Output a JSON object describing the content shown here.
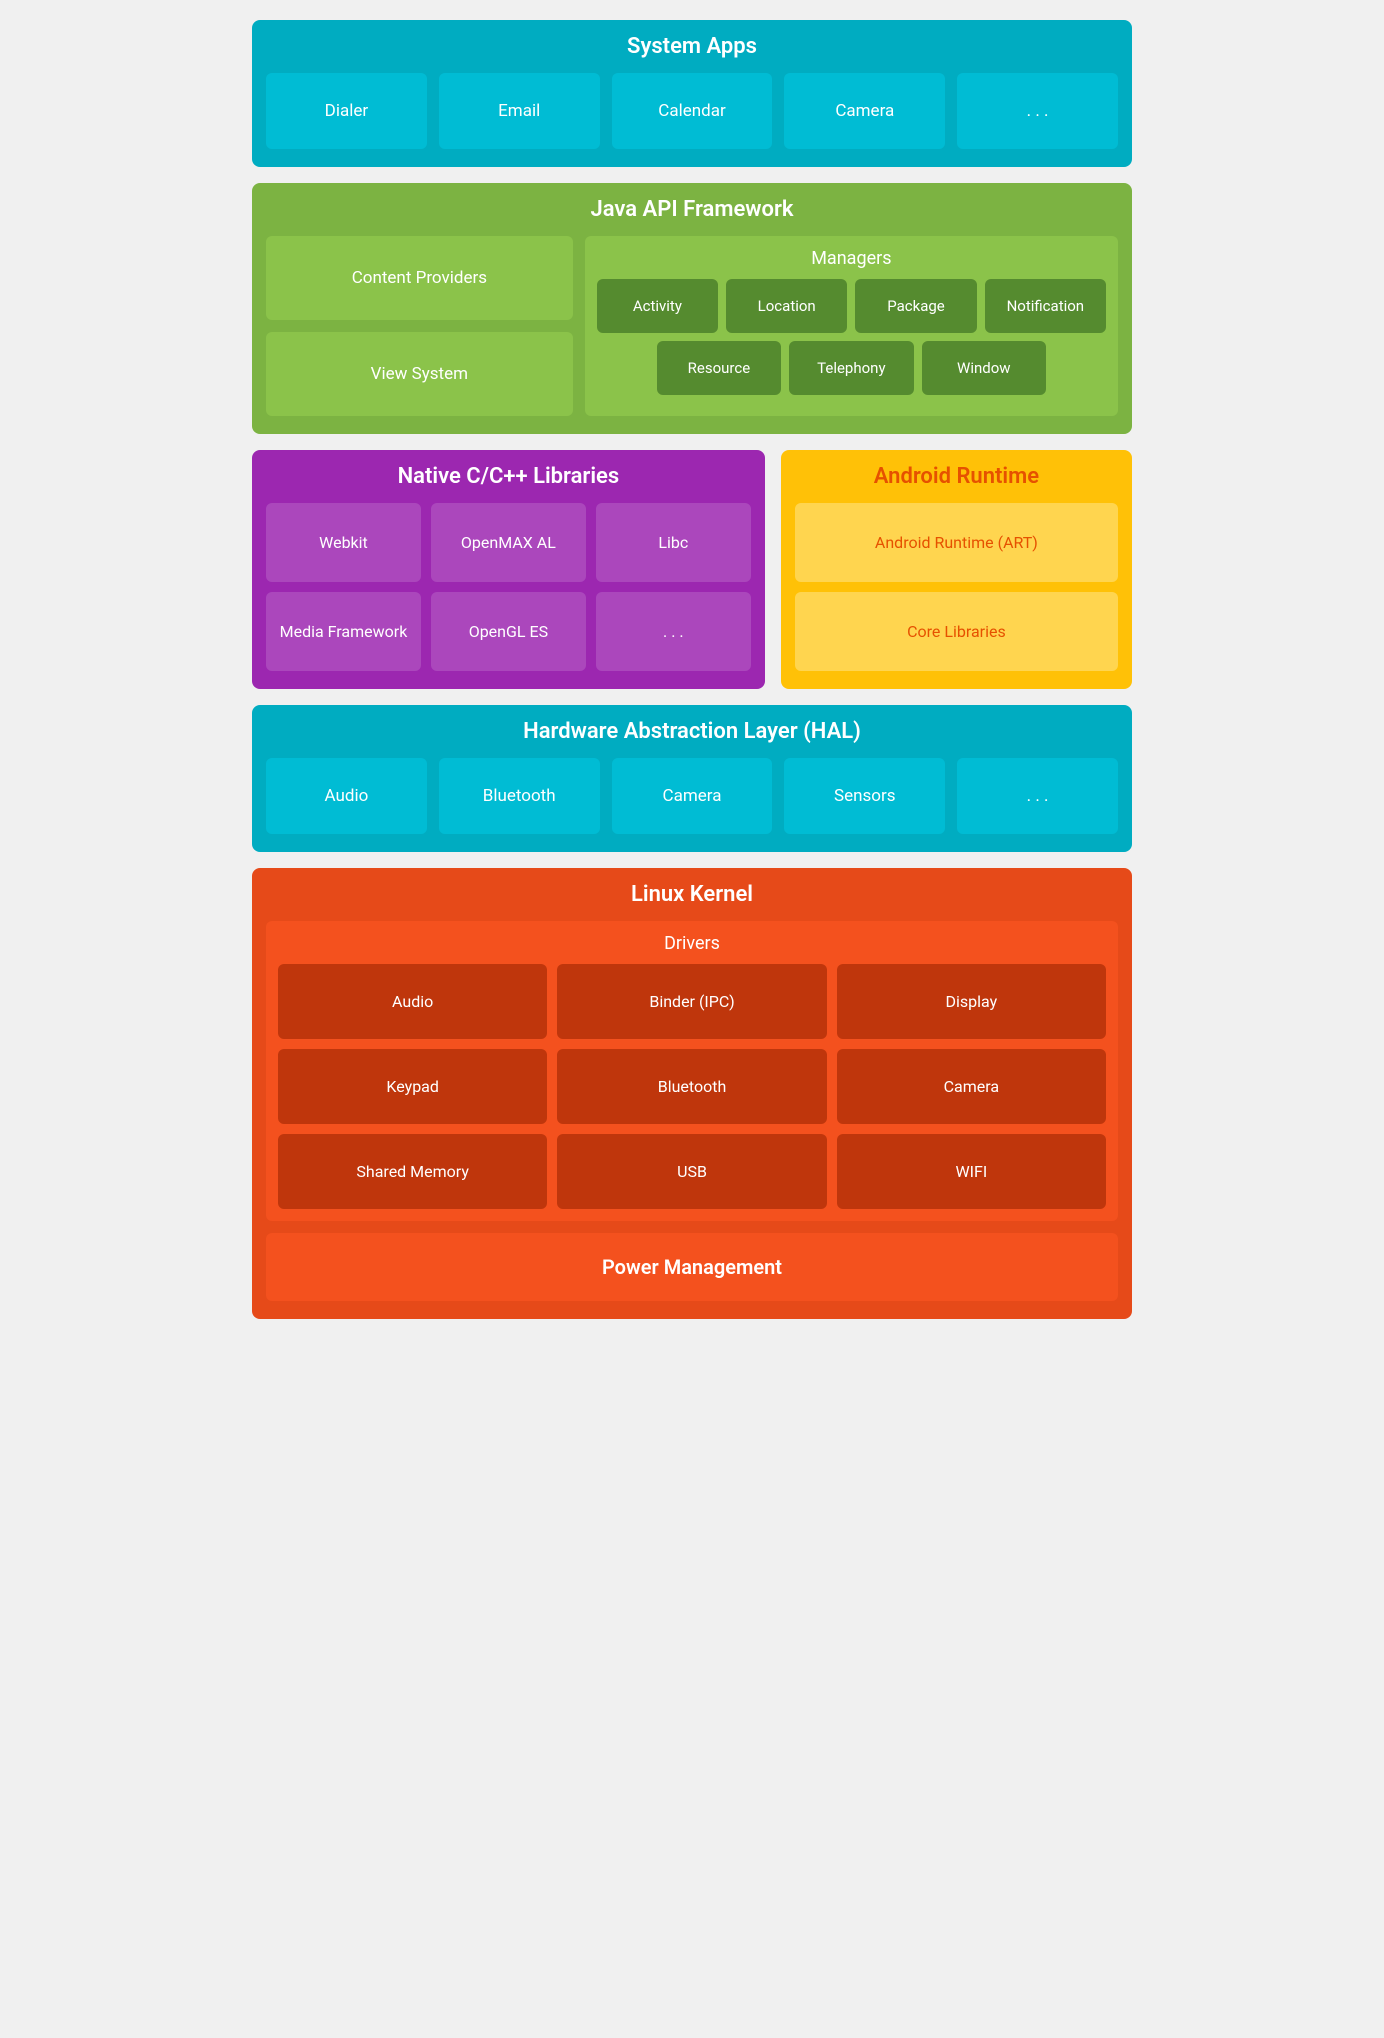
{
  "systemApps": {
    "title": "System Apps",
    "cards": [
      "Dialer",
      "Email",
      "Calendar",
      "Camera",
      ". . ."
    ]
  },
  "javaApi": {
    "title": "Java API Framework",
    "leftCards": [
      "Content Providers",
      "View System"
    ],
    "managers": {
      "title": "Managers",
      "row1": [
        "Activity",
        "Location",
        "Package",
        "Notification"
      ],
      "row2": [
        "Resource",
        "Telephony",
        "Window"
      ]
    }
  },
  "nativeLibs": {
    "title": "Native C/C++ Libraries",
    "cards": [
      "Webkit",
      "OpenMAX AL",
      "Libc",
      "Media Framework",
      "OpenGL ES",
      ". . ."
    ]
  },
  "androidRuntime": {
    "title": "Android Runtime",
    "cards": [
      "Android Runtime (ART)",
      "Core Libraries"
    ]
  },
  "hal": {
    "title": "Hardware Abstraction Layer (HAL)",
    "cards": [
      "Audio",
      "Bluetooth",
      "Camera",
      "Sensors",
      ". . ."
    ]
  },
  "linuxKernel": {
    "title": "Linux Kernel",
    "driversTitle": "Drivers",
    "drivers": [
      "Audio",
      "Binder (IPC)",
      "Display",
      "Keypad",
      "Bluetooth",
      "Camera",
      "Shared Memory",
      "USB",
      "WIFI"
    ],
    "powerManagement": "Power Management"
  }
}
